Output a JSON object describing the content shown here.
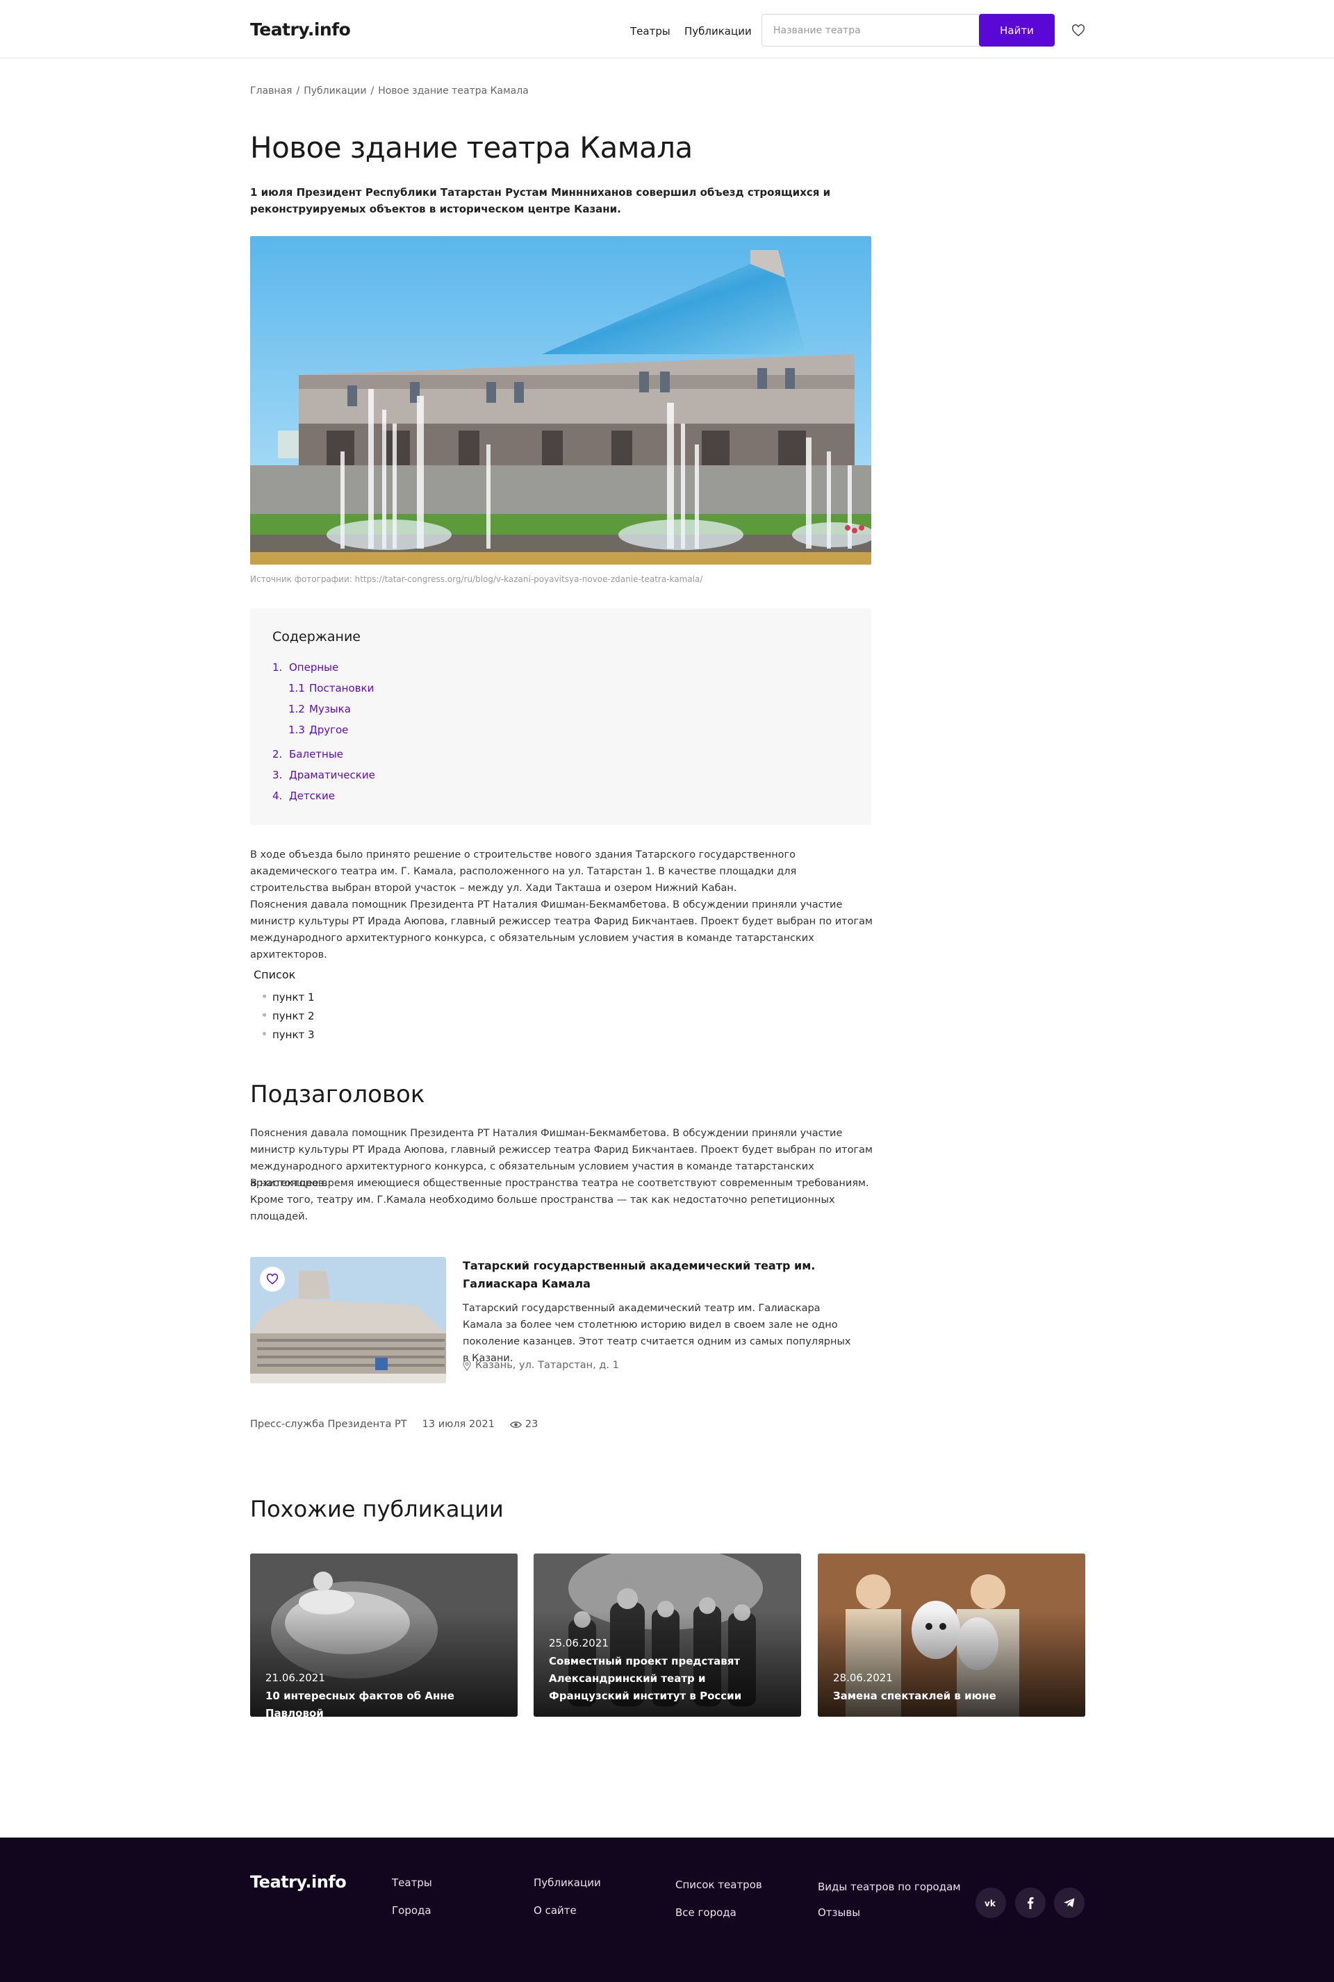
{
  "header": {
    "logo": "Teatry.info",
    "nav": [
      "Театры",
      "Публикации"
    ],
    "search_placeholder": "Название театра",
    "search_button": "Найти"
  },
  "breadcrumb": [
    "Главная",
    "Публикации",
    "Новое здание театра Камала"
  ],
  "article": {
    "title": "Новое здание театра Камала",
    "lead": "1 июля Президент Республики Татарстан Рустам Миннниханов совершил объезд строящихся и реконструируемых объектов в историческом центре Казани.",
    "photo_caption": "Источник фотографии: https://tatar-congress.org/ru/blog/v-kazani-poyavitsya-novoe-zdanie-teatra-kamala/",
    "paragraph1_a": "В ходе объезда было принято решение о строительстве нового здания Татарского государственного академического театра им. Г. Камала, расположенного на ул. Татарстан 1. В качестве площадки для строительства выбран второй участок – между ул. Хади Такташа и озером Нижний Кабан.",
    "paragraph1_b": "Пояснения давала помощник Президента РТ Наталия Фишман-Бекмамбетова. В обсуждении приняли участие министр культуры РТ Ирада Аюпова, главный режиссер театра Фарид Бикчантаев. Проект будет выбран по итогам международного архитектурного конкурса, с обязательным условием участия в команде татарстанских архитекторов.",
    "list_title": "Список",
    "list_items": [
      "пункт 1",
      "пункт 2",
      "пункт 3"
    ],
    "subheading": "Подзаголовок",
    "paragraph2_a": "Пояснения давала помощник Президента РТ Наталия Фишман-Бекмамбетова. В обсуждении приняли участие министр культуры РТ Ирада Аюпова, главный режиссер театра Фарид Бикчантаев. Проект будет выбран по итогам международного архитектурного конкурса, с обязательным условием участия в команде татарстанских архитекторов.",
    "paragraph2_b": "В настоящее время имеющиеся общественные пространства театра не соответствуют современным требованиям. Кроме того, театру им. Г.Камала необходимо больше пространства — так как недостаточно репетиционных площадей."
  },
  "toc": {
    "title": "Содержание",
    "items": [
      {
        "num": "1.",
        "label": "Оперные"
      },
      {
        "num": "1.1",
        "label": "Постановки"
      },
      {
        "num": "1.2",
        "label": "Музыка"
      },
      {
        "num": "1.3",
        "label": "Другое"
      },
      {
        "num": "2.",
        "label": "Балетные"
      },
      {
        "num": "3.",
        "label": "Драматические"
      },
      {
        "num": "4.",
        "label": "Детские"
      }
    ]
  },
  "theatre_card": {
    "title": "Татарский государственный академический театр им. Галиаскара Камала",
    "description": "Татарский государственный академический театр им. Галиаскара Камала за более чем столетнюю историю видел в своем зале не одно поколение казанцев. Этот театр считается одним из самых популярных в Казани.",
    "address": "Казань, ул. Татарстан, д. 1"
  },
  "meta": {
    "source": "Пресс-служба Президента РТ",
    "date": "13 июля 2021",
    "views": "23"
  },
  "related": {
    "title": "Похожие публикации",
    "cards": [
      {
        "date": "21.06.2021",
        "title": "10 интересных фактов об Анне Павловой"
      },
      {
        "date": "25.06.2021",
        "title": "Совместный проект представят Александринский театр и Французский институт в России"
      },
      {
        "date": "28.06.2021",
        "title": "Замена спектаклей в июне"
      }
    ]
  },
  "footer": {
    "logo": "Teatry.info",
    "links": [
      "Театры",
      "Города",
      "Публикации",
      "О сайте",
      "Список театров",
      "Все города",
      "Виды театров по городам",
      "Отзывы"
    ],
    "social": [
      "vk-icon",
      "facebook-icon",
      "telegram-icon"
    ]
  },
  "colors": {
    "accent": "#5a08d6",
    "footer_bg": "#12051e"
  }
}
